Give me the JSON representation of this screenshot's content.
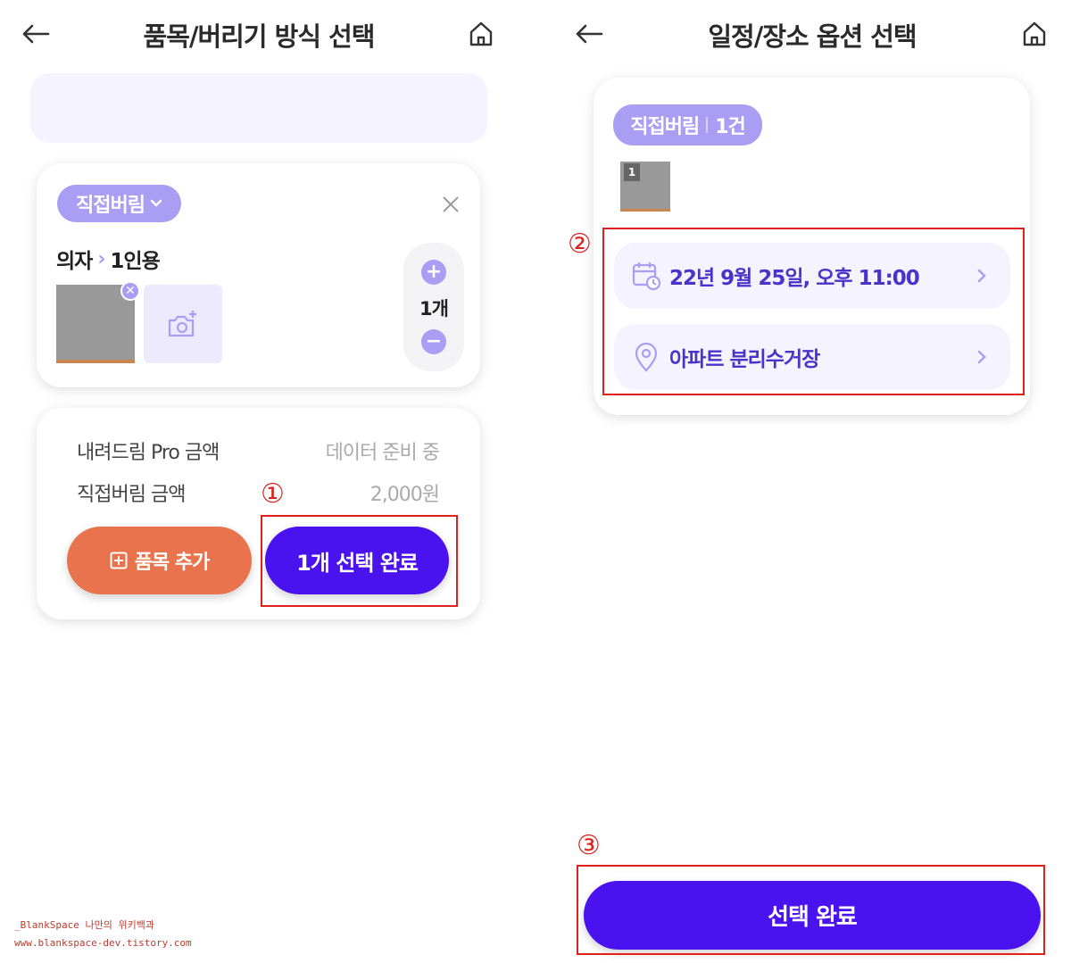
{
  "colors": {
    "accent_light": "#a99ef3",
    "primary": "#4a12ee",
    "orange": "#e8734c",
    "annotation_red": "#e0201c"
  },
  "left": {
    "title": "품목/버리기 방식 선택",
    "back_icon": "arrow-left-icon",
    "home_icon": "home-icon",
    "item": {
      "method_label": "직접버림",
      "category": "의자",
      "subcategory": "1인용",
      "quantity": "1개"
    },
    "prices": [
      {
        "label": "내려드림 Pro 금액",
        "value": "데이터 준비 중"
      },
      {
        "label": "직접버림 금액",
        "value": "2,000원"
      }
    ],
    "add_item_label": "품목 추가",
    "confirm_label": "1개 선택 완료",
    "annotation_marker": "①"
  },
  "right": {
    "title": "일정/장소 옵션 선택",
    "summary": {
      "method_label": "직접버림",
      "count_label": "1건",
      "thumb_count": "1"
    },
    "schedule_text": "22년 9월 25일, 오후 11:00",
    "place_text": "아파트 분리수거장",
    "confirm_label": "선택 완료",
    "annotation_markers": [
      "②",
      "③"
    ]
  },
  "watermark": {
    "line1": "_BlankSpace 나만의 위키백과",
    "line2": "www.blankspace-dev.tistory.com"
  }
}
